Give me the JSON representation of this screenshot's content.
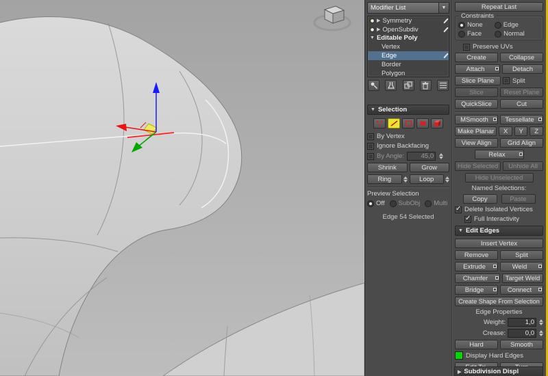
{
  "colors": {
    "accent_strip": "#d9b80b",
    "selection_highlight": "#51718f",
    "active_subobject_yellow": "#ece32f",
    "hard_edge_swatch": "#00d800",
    "axis_x": "#ee1111",
    "axis_y": "#00a800",
    "axis_z": "#1a1aff"
  },
  "modifier_panel": {
    "modifier_list": "Modifier List",
    "stack": {
      "symmetry": "Symmetry",
      "opensubdiv": "OpenSubdiv",
      "editable_poly": "Editable Poly",
      "vertex": "Vertex",
      "edge": "Edge",
      "border": "Border",
      "polygon": "Polygon"
    }
  },
  "selection": {
    "title": "Selection",
    "by_vertex": "By Vertex",
    "ignore_backfacing": "Ignore Backfacing",
    "by_angle": "By Angle:",
    "by_angle_value": "45,0",
    "shrink": "Shrink",
    "grow": "Grow",
    "ring": "Ring",
    "loop": "Loop",
    "preview_selection": "Preview Selection",
    "off": "Off",
    "subobj": "SubObj",
    "multi": "Multi",
    "status": "Edge 54 Selected"
  },
  "edit_geometry": {
    "repeat_last": "Repeat Last",
    "constraints": "Constraints",
    "none": "None",
    "edge": "Edge",
    "face": "Face",
    "normal": "Normal",
    "preserve_uvs": "Preserve UVs",
    "create": "Create",
    "collapse": "Collapse",
    "attach": "Attach",
    "detach": "Detach",
    "slice_plane": "Slice Plane",
    "split_checkbox": "Split",
    "slice": "Slice",
    "reset_plane": "Reset Plane",
    "quickslice": "QuickSlice",
    "cut": "Cut",
    "msmooth": "MSmooth",
    "tessellate": "Tessellate",
    "make_planar": "Make Planar",
    "axis_x": "X",
    "axis_y": "Y",
    "axis_z": "Z",
    "view_align": "View Align",
    "grid_align": "Grid Align",
    "relax": "Relax",
    "hide_selected": "Hide Selected",
    "unhide_all": "Unhide All",
    "hide_unselected": "Hide Unselected",
    "named_selections": "Named Selections:",
    "copy": "Copy",
    "paste": "Paste",
    "delete_isolated_vertices": "Delete Isolated Vertices",
    "full_interactivity": "Full Interactivity"
  },
  "edit_edges": {
    "title": "Edit Edges",
    "insert_vertex": "Insert Vertex",
    "remove": "Remove",
    "split": "Split",
    "extrude": "Extrude",
    "weld": "Weld",
    "chamfer": "Chamfer",
    "target_weld": "Target Weld",
    "bridge": "Bridge",
    "connect": "Connect",
    "create_shape": "Create Shape From Selection",
    "edge_properties": "Edge Properties",
    "weight": "Weight:",
    "weight_value": "1,0",
    "crease": "Crease:",
    "crease_value": "0,0",
    "hard": "Hard",
    "smooth": "Smooth",
    "display_hard_edges": "Display Hard Edges",
    "edit_tri": "Edit Tri.",
    "turn": "Turn"
  },
  "bottom_rollout": {
    "title": "Subdivision Displ"
  }
}
